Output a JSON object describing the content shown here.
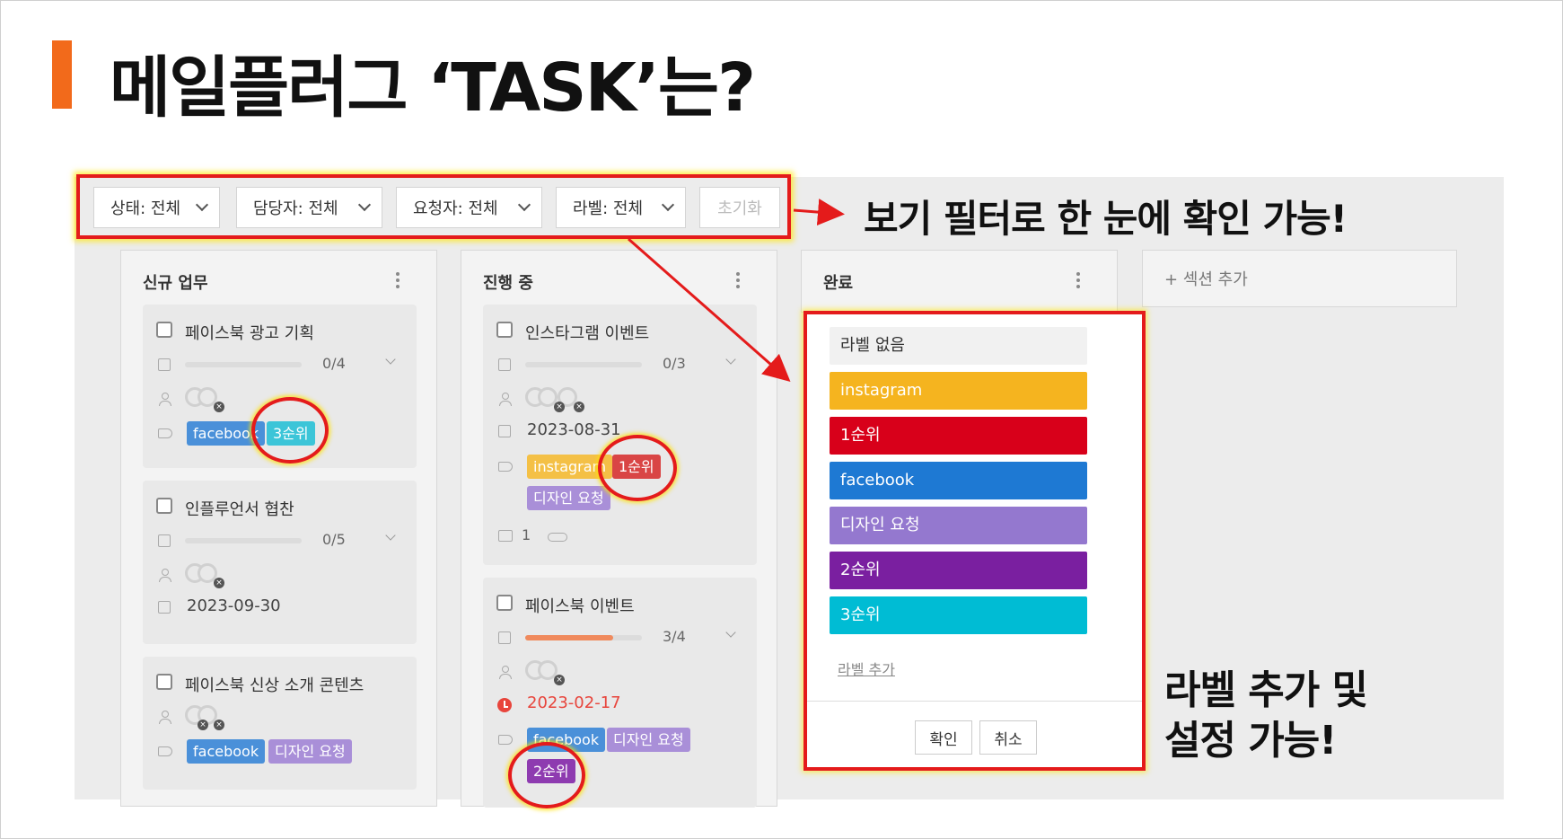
{
  "title": "메일플러그 ‘TASK’는?",
  "colors": {
    "accent": "#f26a1b",
    "highlight": "#e41b1b"
  },
  "filters": {
    "status": "상태: 전체",
    "assignee": "담당자: 전체",
    "requester": "요청자: 전체",
    "label": "라벨: 전체",
    "reset": "초기화"
  },
  "callouts": {
    "filter": "보기 필터로 한 눈에 확인 가능!",
    "label_line1": "라벨 추가 및",
    "label_line2": "설정 가능!"
  },
  "columns": [
    {
      "title": "신규 업무",
      "cards": [
        {
          "title": "페이스북 광고 기획",
          "progress": "0/4",
          "progress_value": 0,
          "labels": [
            "facebook",
            "3순위"
          ]
        },
        {
          "title": "인플루언서 협찬",
          "progress": "0/5",
          "progress_value": 0,
          "date": "2023-09-30"
        },
        {
          "title": "페이스북 신상 소개 콘텐츠",
          "labels": [
            "facebook",
            "디자인 요청"
          ]
        }
      ]
    },
    {
      "title": "진행 중",
      "cards": [
        {
          "title": "인스타그램 이벤트",
          "progress": "0/3",
          "progress_value": 0,
          "date": "2023-08-31",
          "labels": [
            "instagram",
            "1순위",
            "디자인 요청"
          ],
          "comments": "1"
        },
        {
          "title": "페이스북 이벤트",
          "progress": "3/4",
          "progress_value": 0.75,
          "date": "2023-02-17",
          "labels": [
            "facebook",
            "디자인 요청",
            "2순위"
          ]
        }
      ]
    },
    {
      "title": "완료"
    }
  ],
  "section_add": "+ 섹션 추가",
  "label_popup": {
    "options": [
      {
        "name": "라벨 없음",
        "color": "#f1f1f1",
        "text_color": "#333333"
      },
      {
        "name": "instagram",
        "color": "#f5b41f",
        "text_color": "#ffffff"
      },
      {
        "name": "1순위",
        "color": "#d8001a",
        "text_color": "#ffffff"
      },
      {
        "name": "facebook",
        "color": "#1e79d3",
        "text_color": "#ffffff"
      },
      {
        "name": "디자인 요청",
        "color": "#9478cf",
        "text_color": "#ffffff"
      },
      {
        "name": "2순위",
        "color": "#7a1fa0",
        "text_color": "#ffffff"
      },
      {
        "name": "3순위",
        "color": "#00bcd4",
        "text_color": "#ffffff"
      }
    ],
    "add_label": "라벨 추가",
    "confirm": "확인",
    "cancel": "취소"
  },
  "label_colors": {
    "facebook": "#4a90d9",
    "3순위": "#3cc5d8",
    "instagram": "#f4c046",
    "1순위": "#d94545",
    "디자인 요청": "#a98fd8",
    "2순위": "#8e3bb0"
  }
}
